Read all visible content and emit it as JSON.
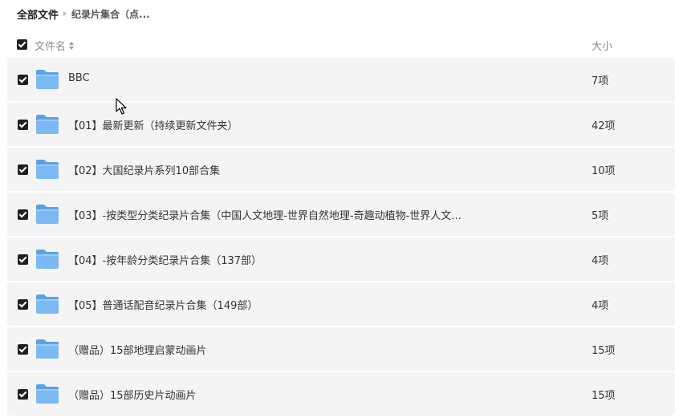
{
  "breadcrumb": {
    "root": "全部文件",
    "current": "纪录片集合（点..."
  },
  "header": {
    "name_label": "文件名",
    "size_label": "大小"
  },
  "files": [
    {
      "name": "BBC",
      "size": "7项"
    },
    {
      "name": "【01】最新更新（持续更新文件夹）",
      "size": "42项"
    },
    {
      "name": "【02】大国纪录片系列10部合集",
      "size": "10项"
    },
    {
      "name": "【03】-按类型分类纪录片合集（中国人文地理-世界自然地理-奇趣动植物-世界人文...",
      "size": "5项"
    },
    {
      "name": "【04】-按年龄分类纪录片合集（137部）",
      "size": "4项"
    },
    {
      "name": "【05】普通话配音纪录片合集（149部）",
      "size": "4项"
    },
    {
      "name": "（赠品）15部地理启蒙动画片",
      "size": "15项"
    },
    {
      "name": "（赠品）15部历史片动画片",
      "size": "15项"
    }
  ],
  "colors": {
    "row_bg": "#f4f4f4",
    "folder_body": "#7cb9f2",
    "folder_tab": "#5aa2e8",
    "checkbox": "#1f1f1f"
  }
}
